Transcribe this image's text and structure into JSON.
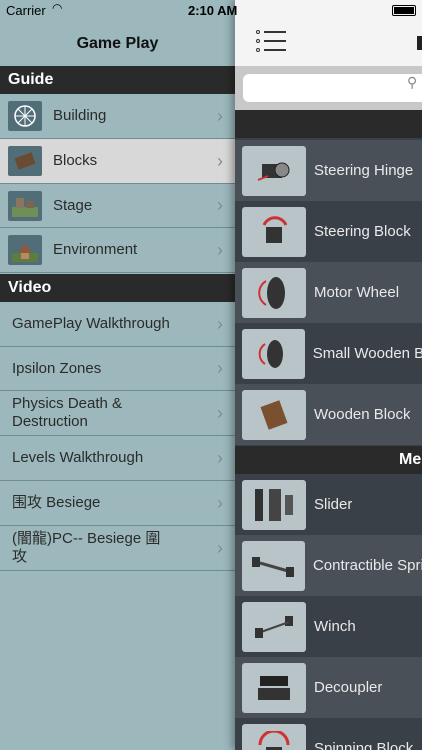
{
  "status_bar": {
    "carrier": "Carrier",
    "time": "2:10 AM"
  },
  "menu": {
    "title": "Game Play",
    "sections": [
      {
        "title": "Guide",
        "items": [
          {
            "label": "Building",
            "icon": "ferris-wheel-icon"
          },
          {
            "label": "Blocks",
            "icon": "block-icon",
            "selected": true
          },
          {
            "label": "Stage",
            "icon": "stage-icon"
          },
          {
            "label": "Environment",
            "icon": "environment-icon"
          }
        ]
      },
      {
        "title": "Video",
        "items": [
          {
            "label": "GamePlay Walkthrough"
          },
          {
            "label": "Ipsilon Zones"
          },
          {
            "label": "Physics Death & Destruction"
          },
          {
            "label": "Levels Walkthrough"
          },
          {
            "label": "围攻 Besiege"
          },
          {
            "label": "(闇龍)PC-- Besiege 圍攻"
          }
        ]
      }
    ]
  },
  "content": {
    "title_fragment": "",
    "search": {
      "placeholder": ""
    },
    "sections": [
      {
        "title": "",
        "items": [
          {
            "label": "Steering Hinge"
          },
          {
            "label": "Steering Block"
          },
          {
            "label": "Motor Wheel"
          },
          {
            "label": "Small Wooden B"
          },
          {
            "label": "Wooden Block"
          }
        ]
      },
      {
        "title": "Me",
        "items": [
          {
            "label": "Slider"
          },
          {
            "label": "Contractible Spri"
          },
          {
            "label": "Winch"
          },
          {
            "label": "Decoupler"
          },
          {
            "label": "Spinning Block"
          }
        ]
      }
    ]
  }
}
